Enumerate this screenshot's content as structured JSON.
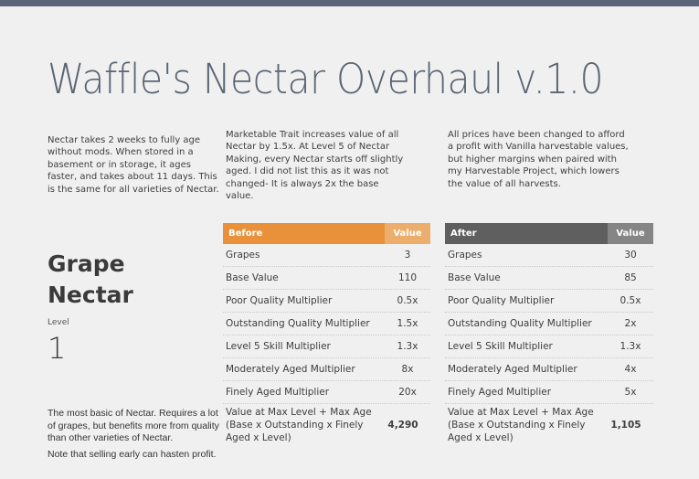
{
  "document": {
    "title": "Waffle's Nectar Overhaul v.1.0",
    "accent_colors": {
      "top_bar": "#5a6579",
      "before_header": "#e8913a",
      "before_value_header": "#ecae6c",
      "after_header": "#5f5f5f",
      "after_value_header": "#858585"
    }
  },
  "intro": {
    "col1": "Nectar takes 2 weeks to fully age without mods. When stored in a basement or in storage, it ages faster, and takes about 11 days. This is the same for all varieties of Nectar.",
    "col2": "Marketable Trait increases value of all Nectar by 1.5x. At Level 5 of Nectar Making, every Nectar starts off slightly aged. I did not list this as it was not changed- It is always 2x the base value.",
    "col3": "All prices have been changed to afford a profit with Vanilla harvestable values, but higher margins when paired with my Harvestable Project, which lowers the value of all harvests."
  },
  "product": {
    "name_line1": "Grape",
    "name_line2": "Nectar",
    "level_label": "Level",
    "level_value": "1",
    "description": "The most basic of Nectar. Requires a lot of grapes, but benefits more from quality than other varieties of Nectar.",
    "note": "Note that selling early can hasten profit."
  },
  "before_table": {
    "header_name": "Before",
    "header_value": "Value",
    "rows": [
      {
        "name": "Grapes",
        "value": "3"
      },
      {
        "name": "Base Value",
        "value": "110"
      },
      {
        "name": "Poor Quality Multiplier",
        "value": "0.5x"
      },
      {
        "name": "Outstanding Quality Multiplier",
        "value": "1.5x"
      },
      {
        "name": "Level 5 Skill Multiplier",
        "value": "1.3x"
      },
      {
        "name": "Moderately Aged Multiplier",
        "value": "8x"
      },
      {
        "name": "Finely Aged Multiplier",
        "value": "20x"
      }
    ],
    "total_label": "Value at Max Level + Max Age (Base x Outstanding x Finely Aged x Level)",
    "total_value": "4,290"
  },
  "after_table": {
    "header_name": "After",
    "header_value": "Value",
    "rows": [
      {
        "name": "Grapes",
        "value": "30"
      },
      {
        "name": "Base Value",
        "value": "85"
      },
      {
        "name": "Poor Quality Multiplier",
        "value": "0.5x"
      },
      {
        "name": "Outstanding Quality Multiplier",
        "value": "2x"
      },
      {
        "name": "Level 5 Skill Multiplier",
        "value": "1.3x"
      },
      {
        "name": "Moderately Aged Multiplier",
        "value": "4x"
      },
      {
        "name": "Finely Aged Multiplier",
        "value": "5x"
      }
    ],
    "total_label": "Value at Max Level + Max Age (Base x Outstanding x Finely Aged x Level)",
    "total_value": "1,105"
  }
}
